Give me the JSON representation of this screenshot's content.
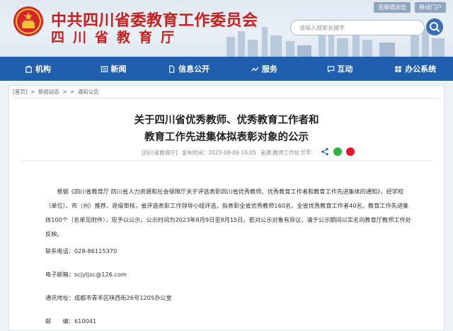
{
  "header": {
    "org_name": "中共四川省委教育工作委员会",
    "dept_name": "四川省教育厅",
    "top_links": [
      "无障碍浏览",
      "移动门户"
    ],
    "search_placeholder": "请输入搜索关键字"
  },
  "nav": {
    "items": [
      {
        "label": "机构",
        "icon": "building-icon"
      },
      {
        "label": "新闻",
        "icon": "news-icon"
      },
      {
        "label": "信息公开",
        "icon": "document-icon"
      },
      {
        "label": "服务",
        "icon": "service-icon"
      },
      {
        "label": "互动",
        "icon": "chat-icon"
      },
      {
        "label": "办公系统",
        "icon": "office-icon"
      }
    ]
  },
  "breadcrumb": [
    "[首页]",
    ">",
    "新闻动态",
    ">",
    ">",
    "通知公告"
  ],
  "article": {
    "title_line1": "关于四川省优秀教师、优秀教育工作者和",
    "title_line2": "教育工作先进集体拟表彰对象的公示",
    "source": "[四川省教育厅]",
    "published": "发布时间：2023-08-09 10:05",
    "department": "来源:教师工作处",
    "share_label": "分享：",
    "body": "根据《四川省教育厅 四川省人力资源和社会保障厅关于评选表彰四川省优秀教师、优秀教育工作者和教育工作先进集体的通知》，经学校（单位）、市（州）推荐、逐级审核，省评选表彰工作领导小组评选，拟表彰全省优秀教师160名、全省优秀教育工作者40名、教育工作先进集体100个（名单见附件），现予以公示，公示时间为2023年8月9日至8月15日。若对公示对象有异议，请于公示期间以实名向教育厅教师工作处反映。",
    "phone": "联系电话：028-86115370",
    "email": "电子邮箱：scjytjsc@126.com",
    "address": "通讯地址：成都市青羊区陕西街26号1205办公室",
    "postcode": "邮　　编：610041"
  },
  "colors": {
    "brand_red": "#c81e1e",
    "nav_blue": "#1f5fae"
  }
}
